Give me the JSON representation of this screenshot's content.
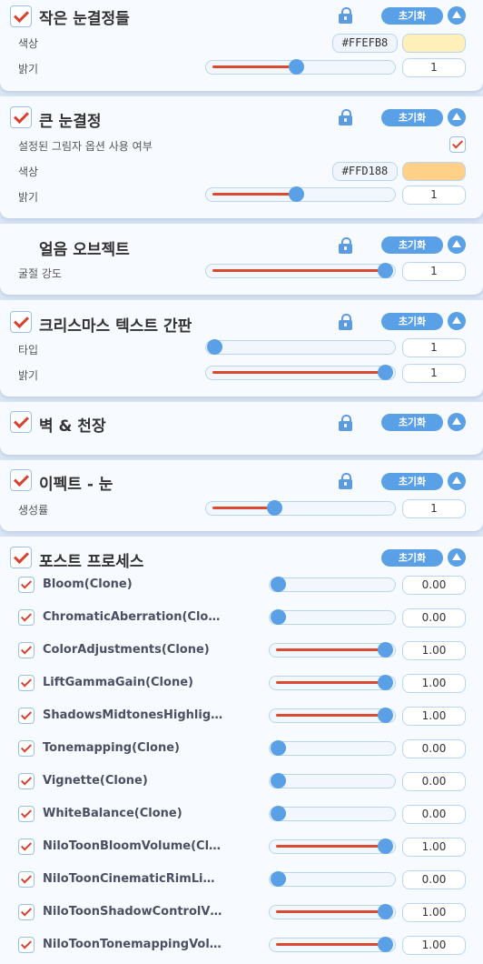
{
  "ui": {
    "reset_label": "초기화",
    "colors": {
      "accent": "#5aa0e6",
      "check": "#d8412e",
      "fill": "#db4a30"
    }
  },
  "small_snowflakes": {
    "title": "작은 눈결정들",
    "enabled": true,
    "color_label": "색상",
    "color_hex": "#FFEFB8",
    "brightness_label": "밝기",
    "brightness_fraction": 0.48,
    "brightness_value": "1"
  },
  "big_snowflake": {
    "title": "큰 눈결정",
    "enabled": true,
    "shadow_option_label": "설정된 그림자 옵션 사용 여부",
    "shadow_option_checked": true,
    "color_label": "색상",
    "color_hex": "#FFD188",
    "brightness_label": "밝기",
    "brightness_fraction": 0.48,
    "brightness_value": "1"
  },
  "ice_object": {
    "title": "얼음 오브젝트",
    "refraction_label": "굴절 강도",
    "refraction_fraction": 1.0,
    "refraction_value": "1"
  },
  "christmas_sign": {
    "title": "크리스마스 텍스트 간판",
    "enabled": true,
    "type_label": "타입",
    "type_fraction": 0.0,
    "type_value": "1",
    "brightness_label": "밝기",
    "brightness_fraction": 1.0,
    "brightness_value": "1"
  },
  "wall_ceiling": {
    "title": "벽 & 천장",
    "enabled": true
  },
  "effect_snow": {
    "title": "이펙트 - 눈",
    "enabled": true,
    "rate_label": "생성률",
    "rate_fraction": 0.35,
    "rate_value": "1"
  },
  "post_process": {
    "title": "포스트 프로세스",
    "enabled": true,
    "items": [
      {
        "name": "Bloom(Clone)",
        "value": "0.00",
        "fraction": 0.0
      },
      {
        "name": "ChromaticAberration(Clo…",
        "value": "0.00",
        "fraction": 0.0
      },
      {
        "name": "ColorAdjustments(Clone)",
        "value": "1.00",
        "fraction": 1.0
      },
      {
        "name": "LiftGammaGain(Clone)",
        "value": "1.00",
        "fraction": 1.0
      },
      {
        "name": "ShadowsMidtonesHighlig…",
        "value": "1.00",
        "fraction": 1.0
      },
      {
        "name": "Tonemapping(Clone)",
        "value": "0.00",
        "fraction": 0.0
      },
      {
        "name": "Vignette(Clone)",
        "value": "0.00",
        "fraction": 0.0
      },
      {
        "name": "WhiteBalance(Clone)",
        "value": "0.00",
        "fraction": 0.0
      },
      {
        "name": "NiloToonBloomVolume(Cl…",
        "value": "1.00",
        "fraction": 1.0
      },
      {
        "name": "NiloToonCinematicRimLi…",
        "value": "0.00",
        "fraction": 0.0
      },
      {
        "name": "NiloToonShadowControlV…",
        "value": "1.00",
        "fraction": 1.0
      },
      {
        "name": "NiloToonTonemappingVol…",
        "value": "1.00",
        "fraction": 1.0
      }
    ]
  }
}
